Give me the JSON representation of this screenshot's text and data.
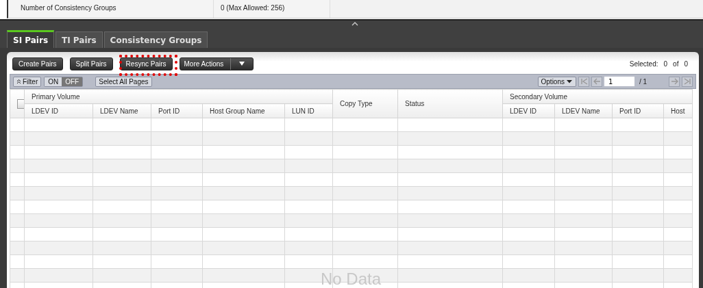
{
  "summary": {
    "label": "Number of Consistency Groups",
    "value": "0 (Max Allowed: 256)"
  },
  "tabs": [
    {
      "label": "SI Pairs",
      "selected": true
    },
    {
      "label": "TI Pairs",
      "selected": false
    },
    {
      "label": "Consistency Groups",
      "selected": false
    }
  ],
  "toolbar": {
    "buttons": [
      {
        "label": "Create Pairs",
        "highlighted": false
      },
      {
        "label": "Split Pairs",
        "highlighted": false
      },
      {
        "label": "Resync Pairs",
        "highlighted": true
      }
    ],
    "more_actions": "More Actions",
    "selected_label": "Selected:",
    "selected_count": "0",
    "of_label": "of",
    "total": "0"
  },
  "filter": {
    "label": "Filter",
    "on_label": "ON",
    "off_label": "OFF",
    "filter_on": false,
    "select_all": "Select All Pages"
  },
  "pagination": {
    "options": "Options",
    "page": "1",
    "of_pages": "/ 1"
  },
  "table": {
    "select_all_checked": false,
    "groups": [
      {
        "label": "Primary Volume",
        "columns": [
          "LDEV ID",
          "LDEV Name",
          "Port ID",
          "Host Group Name",
          "LUN ID"
        ]
      },
      {
        "label": "Copy Type"
      },
      {
        "label": "Status"
      },
      {
        "label": "Secondary Volume",
        "columns": [
          "LDEV ID",
          "LDEV Name",
          "Port ID",
          "Host"
        ]
      }
    ],
    "empty_message": "No Data"
  }
}
